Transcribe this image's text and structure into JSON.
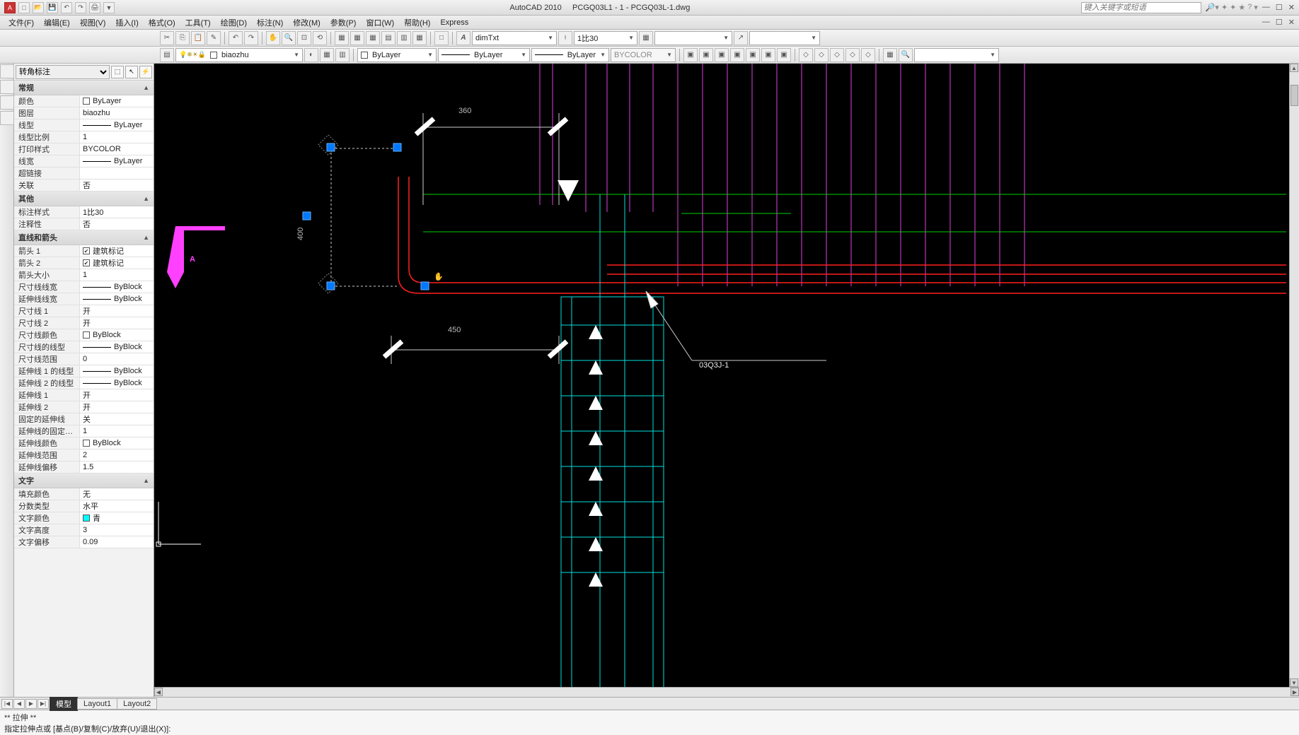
{
  "title_bar": {
    "app": "AutoCAD 2010",
    "doc": "PCGQ03L1 - 1 - PCGQ03L-1.dwg",
    "search_placeholder": "键入关键字或短语"
  },
  "menu": [
    "文件(F)",
    "编辑(E)",
    "视图(V)",
    "插入(I)",
    "格式(O)",
    "工具(T)",
    "绘图(D)",
    "标注(N)",
    "修改(M)",
    "参数(P)",
    "窗口(W)",
    "帮助(H)",
    "Express"
  ],
  "toolbar1": {
    "text_style": "dimTxt",
    "dim_scale": "1比30"
  },
  "toolbar2": {
    "layer": "biaozhu",
    "color": "ByLayer",
    "linetype": "ByLayer",
    "lineweight": "ByLayer",
    "plotstyle": "BYCOLOR"
  },
  "properties": {
    "selector": "转角标注",
    "sections": [
      {
        "title": "常规",
        "rows": [
          {
            "k": "颜色",
            "v": "ByLayer",
            "swatch": "#ffffff"
          },
          {
            "k": "图层",
            "v": "biaozhu"
          },
          {
            "k": "线型",
            "v": "ByLayer",
            "line": true
          },
          {
            "k": "线型比例",
            "v": "1"
          },
          {
            "k": "打印样式",
            "v": "BYCOLOR"
          },
          {
            "k": "线宽",
            "v": "ByLayer",
            "line": true
          },
          {
            "k": "超链接",
            "v": ""
          },
          {
            "k": "关联",
            "v": "否"
          }
        ]
      },
      {
        "title": "其他",
        "rows": [
          {
            "k": "标注样式",
            "v": "1比30"
          },
          {
            "k": "注释性",
            "v": "否"
          }
        ]
      },
      {
        "title": "直线和箭头",
        "rows": [
          {
            "k": "箭头 1",
            "v": "建筑标记",
            "check": true
          },
          {
            "k": "箭头 2",
            "v": "建筑标记",
            "check": true
          },
          {
            "k": "箭头大小",
            "v": "1"
          },
          {
            "k": "尺寸线线宽",
            "v": "ByBlock",
            "line": true
          },
          {
            "k": "延伸线线宽",
            "v": "ByBlock",
            "line": true
          },
          {
            "k": "尺寸线 1",
            "v": "开"
          },
          {
            "k": "尺寸线 2",
            "v": "开"
          },
          {
            "k": "尺寸线颜色",
            "v": "ByBlock",
            "swatch": "#ffffff"
          },
          {
            "k": "尺寸线的线型",
            "v": "ByBlock",
            "line": true
          },
          {
            "k": "尺寸线范围",
            "v": "0"
          },
          {
            "k": "延伸线 1 的线型",
            "v": "ByBlock",
            "line": true
          },
          {
            "k": "延伸线 2 的线型",
            "v": "ByBlock",
            "line": true
          },
          {
            "k": "延伸线 1",
            "v": "开"
          },
          {
            "k": "延伸线 2",
            "v": "开"
          },
          {
            "k": "固定的延伸线",
            "v": "关"
          },
          {
            "k": "延伸线的固定…",
            "v": "1"
          },
          {
            "k": "延伸线颜色",
            "v": "ByBlock",
            "swatch": "#ffffff"
          },
          {
            "k": "延伸线范围",
            "v": "2"
          },
          {
            "k": "延伸线偏移",
            "v": "1.5"
          }
        ]
      },
      {
        "title": "文字",
        "rows": [
          {
            "k": "填充颜色",
            "v": "无"
          },
          {
            "k": "分数类型",
            "v": "水平"
          },
          {
            "k": "文字颜色",
            "v": "青",
            "swatch": "#00ffff"
          },
          {
            "k": "文字高度",
            "v": "3"
          },
          {
            "k": "文字偏移",
            "v": "0.09"
          }
        ]
      }
    ]
  },
  "tabs": {
    "active": "模型",
    "others": [
      "Layout1",
      "Layout2"
    ]
  },
  "command": {
    "line1": "** 拉伸 **",
    "line2": "指定拉伸点或  [基点(B)/复制(C)/放弃(U)/退出(X)]:"
  },
  "canvas_labels": {
    "dim_top": "360",
    "dim_side": "400",
    "dim_bottom": "450",
    "section_mark": "A",
    "callout": "03Q3J-1"
  }
}
